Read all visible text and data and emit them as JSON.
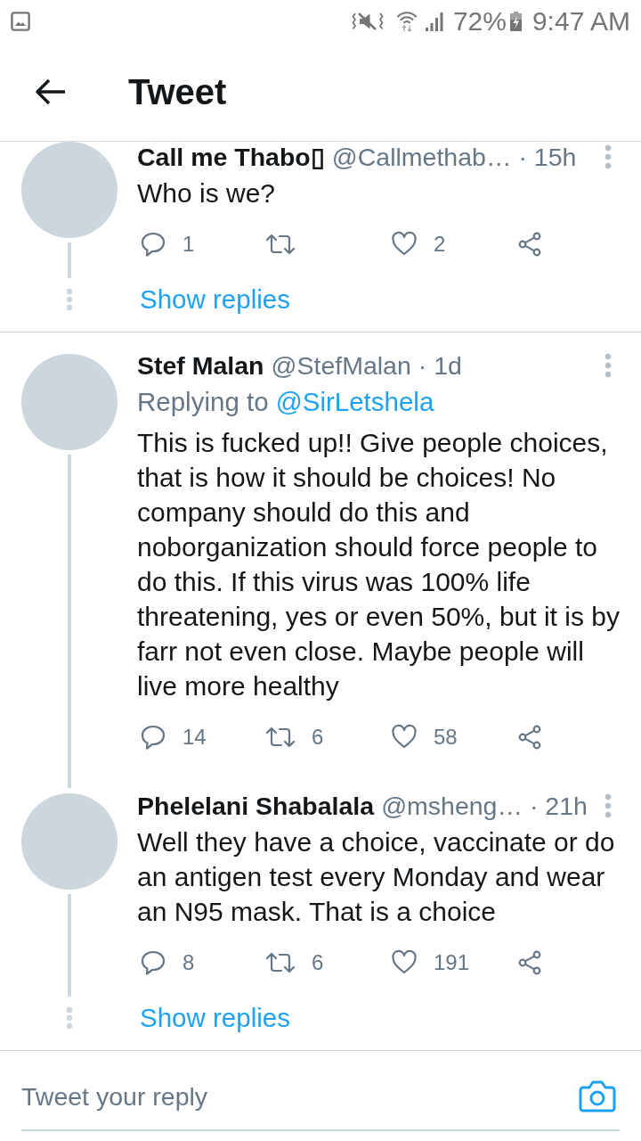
{
  "status_bar": {
    "battery": "72%",
    "time": "9:47 AM"
  },
  "header": {
    "title": "Tweet"
  },
  "threads": [
    {
      "tweets": [
        {
          "name": "Call me Thabo▯",
          "handle": "@Callmethab…",
          "time": "· 15h",
          "text": "Who is we?",
          "actions": [
            {
              "kind": "reply",
              "count": "1"
            },
            {
              "kind": "retweet"
            },
            {
              "kind": "like",
              "count": "2"
            },
            {
              "kind": "share"
            }
          ]
        }
      ],
      "show_replies": "Show replies"
    },
    {
      "tweets": [
        {
          "name": "Stef Malan",
          "handle": "@StefMalan",
          "time": "· 1d",
          "replying_to": {
            "label": "Replying to",
            "handle": "@SirLetshela"
          },
          "text": "This is fucked up!! Give people choices, that is how it should be choices! No company should do this and noborganization should force people to do this. If this virus was 100% life threatening, yes or even 50%, but it is by farr not even close. Maybe people will live more healthy",
          "actions": [
            {
              "kind": "reply",
              "count": "14"
            },
            {
              "kind": "retweet",
              "count": "6"
            },
            {
              "kind": "like",
              "count": "58"
            },
            {
              "kind": "share"
            }
          ]
        },
        {
          "name": "Phelelani Shabalala",
          "handle": "@msheng…",
          "time": "· 21h",
          "text": "Well they have a choice, vaccinate or do an antigen test every Monday and wear an N95 mask. That is a choice",
          "actions": [
            {
              "kind": "reply",
              "count": "8"
            },
            {
              "kind": "retweet",
              "count": "6"
            },
            {
              "kind": "like",
              "count": "191"
            },
            {
              "kind": "share"
            }
          ]
        }
      ],
      "show_replies": "Show replies"
    }
  ],
  "reply_box": {
    "placeholder": "Tweet your reply"
  }
}
